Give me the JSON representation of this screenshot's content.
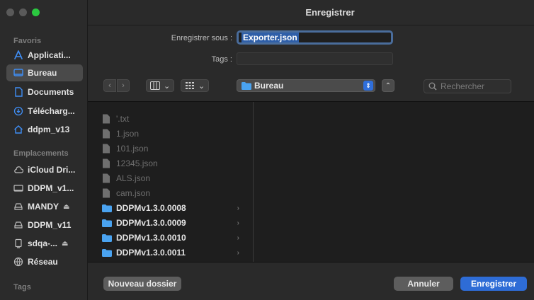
{
  "window": {
    "title": "Enregistrer"
  },
  "sidebar": {
    "sections": {
      "favorites": "Favoris",
      "locations": "Emplacements",
      "tags": "Tags"
    },
    "favorites": [
      {
        "label": "Applicati...",
        "icon": "applications-icon"
      },
      {
        "label": "Bureau",
        "icon": "desktop-icon",
        "active": true
      },
      {
        "label": "Documents",
        "icon": "document-icon"
      },
      {
        "label": "Télécharg...",
        "icon": "download-icon"
      },
      {
        "label": "ddpm_v13",
        "icon": "home-icon"
      }
    ],
    "locations": [
      {
        "label": "iCloud Dri...",
        "icon": "cloud-icon"
      },
      {
        "label": "DDPM_v1...",
        "icon": "display-icon"
      },
      {
        "label": "MANDY",
        "icon": "drive-icon",
        "eject": "⏏"
      },
      {
        "label": "DDPM_v11",
        "icon": "drive-icon"
      },
      {
        "label": "sdqa-...",
        "icon": "disk-icon",
        "eject": "⏏"
      },
      {
        "label": "Réseau",
        "icon": "network-icon"
      }
    ]
  },
  "form": {
    "save_as_label": "Enregistrer sous :",
    "save_as_value": "Exporter.json",
    "tags_label": "Tags :",
    "tags_value": ""
  },
  "toolbar": {
    "back": "‹",
    "forward": "›",
    "location": "Bureau",
    "search_placeholder": "Rechercher"
  },
  "files": [
    {
      "name": "'.txt",
      "type": "file",
      "enabled": false
    },
    {
      "name": "1.json",
      "type": "file",
      "enabled": false
    },
    {
      "name": "101.json",
      "type": "file",
      "enabled": false
    },
    {
      "name": "12345.json",
      "type": "file",
      "enabled": false
    },
    {
      "name": "ALS.json",
      "type": "file",
      "enabled": false
    },
    {
      "name": "cam.json",
      "type": "file",
      "enabled": false
    },
    {
      "name": "DDPMv1.3.0.0008",
      "type": "folder",
      "enabled": true
    },
    {
      "name": "DDPMv1.3.0.0009",
      "type": "folder",
      "enabled": true
    },
    {
      "name": "DDPMv1.3.0.0010",
      "type": "folder",
      "enabled": true
    },
    {
      "name": "DDPMv1.3.0.0011",
      "type": "folder",
      "enabled": true
    }
  ],
  "buttons": {
    "new_folder": "Nouveau dossier",
    "cancel": "Annuler",
    "save": "Enregistrer"
  },
  "colors": {
    "accent": "#2e6cd6",
    "folder": "#4aa3f0"
  }
}
